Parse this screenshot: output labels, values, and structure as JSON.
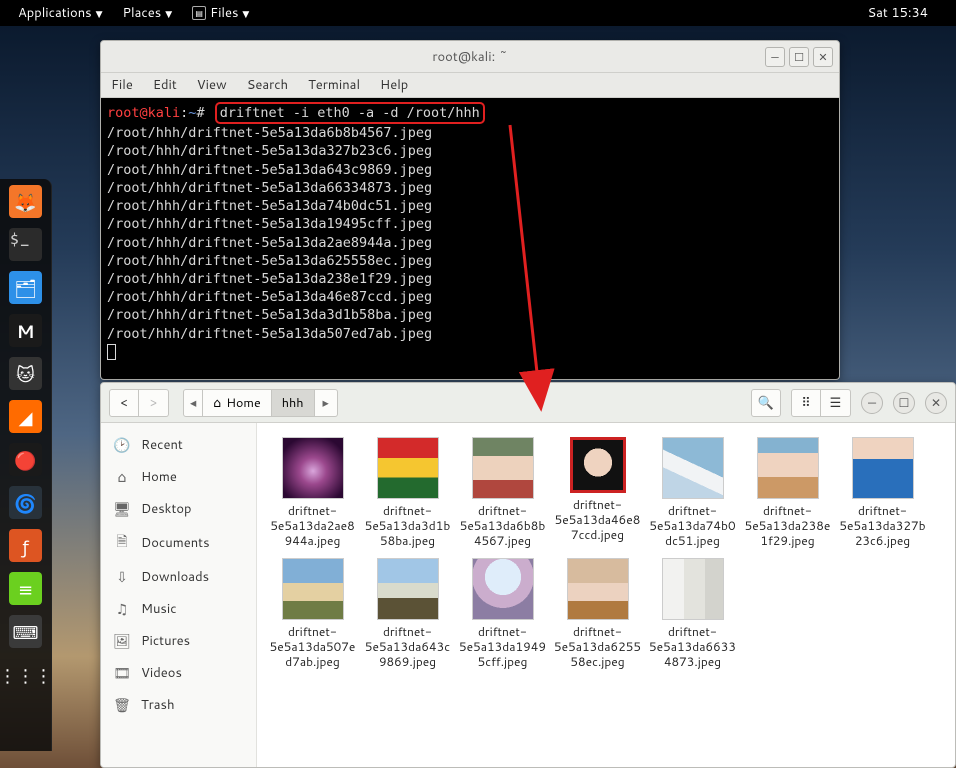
{
  "panel": {
    "apps": "Applications",
    "places": "Places",
    "files": "Files",
    "clock": "Sat 15:34"
  },
  "terminal": {
    "title": "root@kali: ~",
    "menu": [
      "File",
      "Edit",
      "View",
      "Search",
      "Terminal",
      "Help"
    ],
    "prompt_user": "root@kali",
    "prompt_path": "~",
    "command": "driftnet -i eth0 -a -d /root/hhh",
    "output": [
      "/root/hhh/driftnet-5e5a13da6b8b4567.jpeg",
      "/root/hhh/driftnet-5e5a13da327b23c6.jpeg",
      "/root/hhh/driftnet-5e5a13da643c9869.jpeg",
      "/root/hhh/driftnet-5e5a13da66334873.jpeg",
      "/root/hhh/driftnet-5e5a13da74b0dc51.jpeg",
      "/root/hhh/driftnet-5e5a13da19495cff.jpeg",
      "/root/hhh/driftnet-5e5a13da2ae8944a.jpeg",
      "/root/hhh/driftnet-5e5a13da625558ec.jpeg",
      "/root/hhh/driftnet-5e5a13da238e1f29.jpeg",
      "/root/hhh/driftnet-5e5a13da46e87ccd.jpeg",
      "/root/hhh/driftnet-5e5a13da3d1b58ba.jpeg",
      "/root/hhh/driftnet-5e5a13da507ed7ab.jpeg"
    ]
  },
  "files": {
    "breadcrumb_home": "Home",
    "breadcrumb_current": "hhh",
    "sidebar": [
      {
        "icon": "🕑",
        "label": "Recent"
      },
      {
        "icon": "⌂",
        "label": "Home"
      },
      {
        "icon": "🖥",
        "label": "Desktop"
      },
      {
        "icon": "🗎",
        "label": "Documents"
      },
      {
        "icon": "⇩",
        "label": "Downloads"
      },
      {
        "icon": "♫",
        "label": "Music"
      },
      {
        "icon": "🖼",
        "label": "Pictures"
      },
      {
        "icon": "🎞",
        "label": "Videos"
      },
      {
        "icon": "🗑",
        "label": "Trash"
      }
    ],
    "items": [
      "driftnet-5e5a13da2ae8944a.jpeg",
      "driftnet-5e5a13da3d1b58ba.jpeg",
      "driftnet-5e5a13da6b8b4567.jpeg",
      "driftnet-5e5a13da46e87ccd.jpeg",
      "driftnet-5e5a13da74b0dc51.jpeg",
      "driftnet-5e5a13da238e1f29.jpeg",
      "driftnet-5e5a13da327b23c6.jpeg",
      "driftnet-5e5a13da507ed7ab.jpeg",
      "driftnet-5e5a13da643c9869.jpeg",
      "driftnet-5e5a13da19495cff.jpeg",
      "driftnet-5e5a13da625558ec.jpeg",
      "driftnet-5e5a13da66334873.jpeg"
    ]
  }
}
